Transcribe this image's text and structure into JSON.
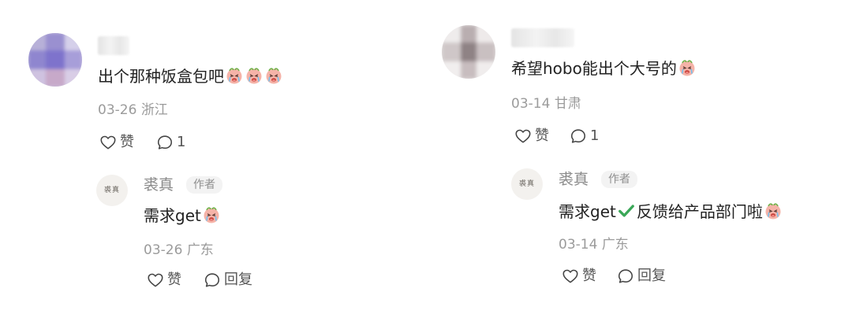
{
  "comments": [
    {
      "text": "出个那种饭盒包吧",
      "emoji_count": 3,
      "date": "03-26",
      "location": "浙江",
      "like_label": "赞",
      "reply_count": "1",
      "reply": {
        "username": "裘真",
        "badge": "作者",
        "text": "需求get",
        "date": "03-26",
        "location": "广东",
        "like_label": "赞",
        "reply_label": "回复",
        "avatar_text": "裘真"
      }
    },
    {
      "text": "希望hobo能出个大号的",
      "emoji_count": 1,
      "date": "03-14",
      "location": "甘肃",
      "like_label": "赞",
      "reply_count": "1",
      "reply": {
        "username": "裘真",
        "badge": "作者",
        "text_before": "需求get",
        "text_after": "反馈给产品部门啦",
        "date": "03-14",
        "location": "广东",
        "like_label": "赞",
        "reply_label": "回复",
        "avatar_text": "裘真"
      }
    }
  ],
  "icons": {
    "like": "heart-outline-icon",
    "comment": "speech-bubble-icon",
    "emoji": "crying-face-emoji",
    "check": "green-check-icon"
  },
  "colors": {
    "text": "#222222",
    "meta": "#9b9b9b",
    "badge_bg": "#f3f3f3",
    "check_green": "#3aa757",
    "emoji_pink": "#f2a3a3"
  }
}
